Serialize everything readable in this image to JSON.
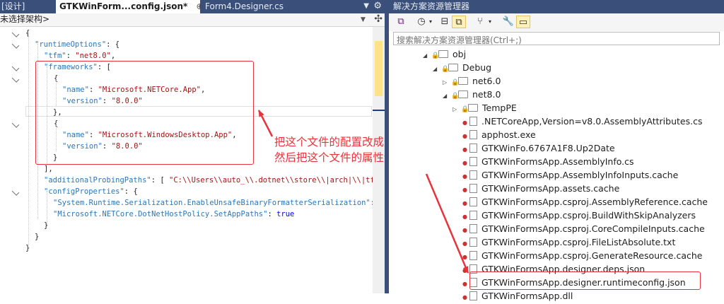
{
  "editor": {
    "tabs": [
      {
        "label": "[设计]",
        "active": false
      },
      {
        "label": "GTKWinForm...config.json*",
        "active": true,
        "pin": "⊕",
        "close": "×"
      },
      {
        "label": "Form4.Designer.cs",
        "active": false
      }
    ],
    "nav_combo": "未选择架构>",
    "code_lines": [
      [
        {
          "t": "{",
          "c": "p"
        }
      ],
      [
        {
          "t": "\"runtimeOptions\"",
          "c": "k"
        },
        {
          "t": ": {",
          "c": "p"
        }
      ],
      [
        {
          "t": "\"tfm\"",
          "c": "k"
        },
        {
          "t": ": ",
          "c": "p"
        },
        {
          "t": "\"net8.0\"",
          "c": "s"
        },
        {
          "t": ",",
          "c": "p"
        }
      ],
      [
        {
          "t": "\"frameworks\"",
          "c": "k"
        },
        {
          "t": ": [",
          "c": "p"
        }
      ],
      [
        {
          "t": "{",
          "c": "p"
        }
      ],
      [
        {
          "t": "\"name\"",
          "c": "k"
        },
        {
          "t": ": ",
          "c": "p"
        },
        {
          "t": "\"Microsoft.NETCore.App\"",
          "c": "s"
        },
        {
          "t": ",",
          "c": "p"
        }
      ],
      [
        {
          "t": "\"version\"",
          "c": "k"
        },
        {
          "t": ": ",
          "c": "p"
        },
        {
          "t": "\"8.0.0\"",
          "c": "s"
        }
      ],
      [
        {
          "t": "},",
          "c": "p"
        }
      ],
      [
        {
          "t": "{",
          "c": "p"
        }
      ],
      [
        {
          "t": "\"name\"",
          "c": "k"
        },
        {
          "t": ": ",
          "c": "p"
        },
        {
          "t": "\"Microsoft.WindowsDesktop.App\"",
          "c": "s"
        },
        {
          "t": ",",
          "c": "p"
        }
      ],
      [
        {
          "t": "\"version\"",
          "c": "k"
        },
        {
          "t": ": ",
          "c": "p"
        },
        {
          "t": "\"8.0.0\"",
          "c": "s"
        }
      ],
      [
        {
          "t": "}",
          "c": "p"
        }
      ],
      [
        {
          "t": "],",
          "c": "p"
        }
      ],
      [
        {
          "t": "\"additionalProbingPaths\"",
          "c": "k"
        },
        {
          "t": ": [ ",
          "c": "p"
        },
        {
          "t": "\"C:\\\\Users\\\\auto_\\\\.dotnet\\\\store\\\\|arch|\\\\|tfm",
          "c": "s"
        }
      ],
      [
        {
          "t": "\"configProperties\"",
          "c": "k"
        },
        {
          "t": ": {",
          "c": "p"
        }
      ],
      [
        {
          "t": "\"System.Runtime.Serialization.EnableUnsafeBinaryFormatterSerialization\"",
          "c": "k"
        },
        {
          "t": ":",
          "c": "p"
        }
      ],
      [
        {
          "t": "\"Microsoft.NETCore.DotNetHostPolicy.SetAppPaths\"",
          "c": "k"
        },
        {
          "t": ": ",
          "c": "p"
        },
        {
          "t": "true",
          "c": "b"
        }
      ],
      [
        {
          "t": "}",
          "c": "p"
        }
      ],
      [
        {
          "t": "}",
          "c": "p"
        }
      ],
      [
        {
          "t": "}",
          "c": "p"
        }
      ]
    ],
    "annotation_line1": "把这个文件的配置改成这样",
    "annotation_line2": "然后把这个文件的属性设为只读"
  },
  "explorer": {
    "title": "解决方案资源管理器",
    "search_placeholder": "搜索解决方案资源管理器(Ctrl+;)",
    "toolbar_icons": [
      "vs-switch-icon",
      "history-icon",
      "dropdown-arrow-icon",
      "collapse-all-icon",
      "show-all-files-icon",
      "pending-changes-icon",
      "dropdown-arrow-icon",
      "properties-icon",
      "preview-icon"
    ],
    "tree": [
      {
        "label": "obj",
        "type": "folder",
        "expander": "open",
        "lock": true
      },
      {
        "label": "Debug",
        "type": "folder",
        "expander": "open",
        "lock": true
      },
      {
        "label": "net6.0",
        "type": "folder",
        "expander": "closed",
        "lock": true
      },
      {
        "label": "net8.0",
        "type": "folder",
        "expander": "open",
        "lock": true
      },
      {
        "label": "TempPE",
        "type": "folder",
        "expander": "closed",
        "lock": true
      },
      {
        "label": ".NETCoreApp,Version=v8.0.AssemblyAttributes.cs",
        "type": "file"
      },
      {
        "label": "apphost.exe",
        "type": "file"
      },
      {
        "label": "GTKWinFo.6767A1F8.Up2Date",
        "type": "file"
      },
      {
        "label": "GTKWinFormsApp.AssemblyInfo.cs",
        "type": "file"
      },
      {
        "label": "GTKWinFormsApp.AssemblyInfoInputs.cache",
        "type": "file"
      },
      {
        "label": "GTKWinFormsApp.assets.cache",
        "type": "file"
      },
      {
        "label": "GTKWinFormsApp.csproj.AssemblyReference.cache",
        "type": "file"
      },
      {
        "label": "GTKWinFormsApp.csproj.BuildWithSkipAnalyzers",
        "type": "file"
      },
      {
        "label": "GTKWinFormsApp.csproj.CoreCompileInputs.cache",
        "type": "file"
      },
      {
        "label": "GTKWinFormsApp.csproj.FileListAbsolute.txt",
        "type": "file"
      },
      {
        "label": "GTKWinFormsApp.csproj.GenerateResource.cache",
        "type": "file"
      },
      {
        "label": "GTKWinFormsApp.designer.deps.json",
        "type": "file"
      },
      {
        "label": "GTKWinFormsApp.designer.runtimeconfig.json",
        "type": "file",
        "highlighted": true
      },
      {
        "label": "GTKWinFormsApp.dll",
        "type": "file"
      }
    ]
  },
  "colors": {
    "accent": "#e8323c",
    "keyword": "#2e75b6",
    "string": "#a31515",
    "bool": "#0000ff",
    "chrome": "#3a4f7a"
  }
}
